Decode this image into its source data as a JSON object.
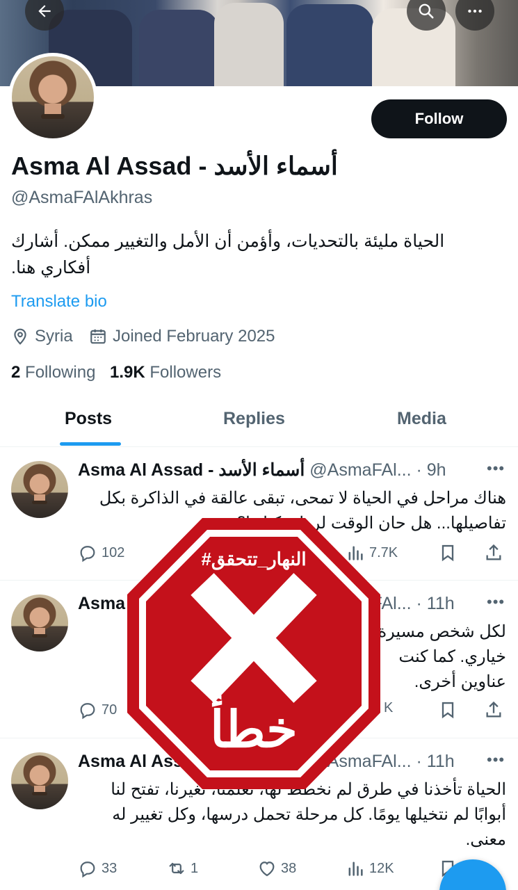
{
  "profile": {
    "name": "Asma Al Assad - أسماء الأسد",
    "handle": "@AsmaFAlAkhras",
    "bio_line1": "الحياة مليئة بالتحديات، وأؤمن أن الأمل والتغيير ممكن. أشارك",
    "bio_line2": "أفكاري هنا.",
    "translate_label": "Translate bio",
    "location": "Syria",
    "joined": "Joined February 2025",
    "following_count": "2",
    "following_label": "Following",
    "followers_count": "1.9K",
    "followers_label": "Followers",
    "follow_button": "Follow"
  },
  "tabs": [
    {
      "label": "Posts",
      "active": true
    },
    {
      "label": "Replies",
      "active": false
    },
    {
      "label": "Media",
      "active": false
    }
  ],
  "posts": [
    {
      "name": "Asma Al Assad - أسماء الأسد",
      "handle": "@AsmaFAl...",
      "time": "· 9h",
      "line1": "هناك مراحل في الحياة لا تمحى، تبقى عالقة في الذاكرة بكل",
      "line2": "تفاصيلها... هل حان الوقت لرواية كتابها؟",
      "line3": "",
      "replies": "102",
      "reposts": "",
      "likes": "",
      "views": "7.7K"
    },
    {
      "name": "Asma Al Assad - أسماء الأسد",
      "handle": "@AsmaFAl...",
      "time": "· 11h",
      "line1": "لكل شخص مسيرة، وهناك لحظات لم تكن يومًا",
      "line2": "خياري. كما كنت",
      "line3": "عناوين أخرى.",
      "replies": "70",
      "reposts": "",
      "likes": "",
      "views": "K"
    },
    {
      "name": "Asma Al Assad - أسماء الأسد",
      "handle": "@AsmaFAl...",
      "time": "· 11h",
      "line1": "الحياة تأخذنا في طرق لم نخطط لها، تعلمنا، تغيرنا، تفتح لنا",
      "line2": "أبوابًا لم نتخيلها يومًا. كل مرحلة تحمل درسها، وكل تغيير له",
      "line3": "معنى.",
      "replies": "33",
      "reposts": "1",
      "likes": "38",
      "views": "12K"
    }
  ],
  "stamp": {
    "hashtag": "#النهار_تتحقق",
    "verdict": "خطأ",
    "color": "#c4111b"
  },
  "colors": {
    "accent": "#1d9bf0",
    "text": "#0f1419",
    "muted": "#536471"
  }
}
